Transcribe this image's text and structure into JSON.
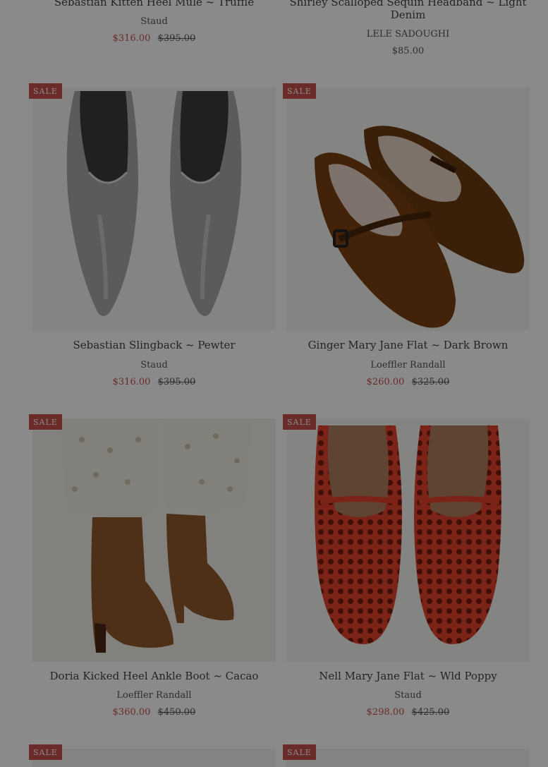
{
  "top_row": [
    {
      "title": "Sebastian Kitten Heel Mule ~ Truffle",
      "vendor": "Staud",
      "price": "$316.00",
      "compare_price": "$395.00"
    },
    {
      "title_line1": "Shirley Scalloped Sequin Headband ~ Light",
      "title_line2": "Denim",
      "vendor": "LELE SADOUGHI",
      "price": "$85.00"
    }
  ],
  "products": [
    {
      "badge": "SALE",
      "title": "Sebastian Slingback ~ Pewter",
      "vendor": "Staud",
      "price": "$316.00",
      "compare_price": "$395.00",
      "image_icon": "silver-pointed-slingback"
    },
    {
      "badge": "SALE",
      "title": "Ginger Mary Jane Flat ~ Dark Brown",
      "vendor": "Loeffler Randall",
      "price": "$260.00",
      "compare_price": "$325.00",
      "image_icon": "brown-velvet-mary-jane"
    },
    {
      "badge": "SALE",
      "title": "Doria Kicked Heel Ankle Boot ~ Cacao",
      "vendor": "Loeffler Randall",
      "price": "$360.00",
      "compare_price": "$450.00",
      "image_icon": "suede-ankle-boot"
    },
    {
      "badge": "SALE",
      "title": "Nell Mary Jane Flat ~ Wld Poppy",
      "vendor": "Staud",
      "price": "$298.00",
      "compare_price": "$425.00",
      "image_icon": "red-woven-mary-jane"
    }
  ],
  "bottom_row": [
    {
      "badge": "SALE"
    },
    {
      "badge": "SALE"
    }
  ],
  "colors": {
    "sale": "#c4514d",
    "badge_bg": "#c4514d",
    "text": "#444444",
    "overlay": "rgba(0,0,0,0.46)"
  }
}
